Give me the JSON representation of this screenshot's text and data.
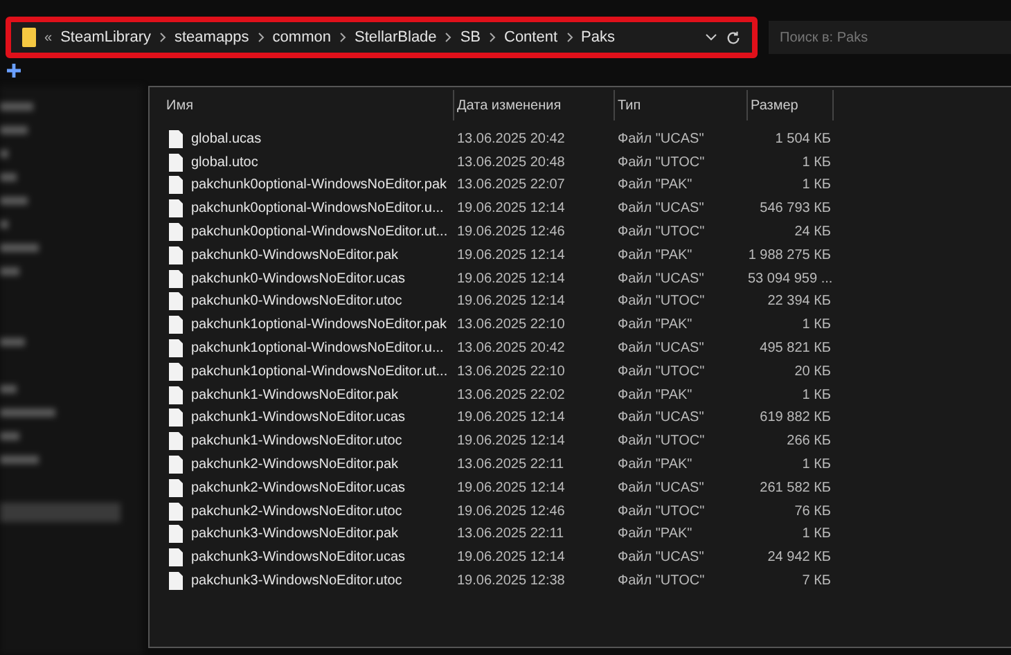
{
  "address_bar": {
    "overflow": "«",
    "crumbs": [
      "SteamLibrary",
      "steamapps",
      "common",
      "StellarBlade",
      "SB",
      "Content",
      "Paks"
    ],
    "highlighted": true
  },
  "search": {
    "placeholder": "Поиск в: Paks"
  },
  "table": {
    "columns": [
      "Имя",
      "Дата изменения",
      "Тип",
      "Размер"
    ],
    "rows": [
      {
        "name": "global.ucas",
        "date": "13.06.2025 20:42",
        "type": "Файл \"UCAS\"",
        "size": "1 504 КБ"
      },
      {
        "name": "global.utoc",
        "date": "13.06.2025 20:48",
        "type": "Файл \"UTOC\"",
        "size": "1 КБ"
      },
      {
        "name": "pakchunk0optional-WindowsNoEditor.pak",
        "date": "13.06.2025 22:07",
        "type": "Файл \"PAK\"",
        "size": "1 КБ"
      },
      {
        "name": "pakchunk0optional-WindowsNoEditor.u...",
        "date": "19.06.2025 12:14",
        "type": "Файл \"UCAS\"",
        "size": "546 793 КБ"
      },
      {
        "name": "pakchunk0optional-WindowsNoEditor.ut...",
        "date": "19.06.2025 12:46",
        "type": "Файл \"UTOC\"",
        "size": "24 КБ"
      },
      {
        "name": "pakchunk0-WindowsNoEditor.pak",
        "date": "19.06.2025 12:14",
        "type": "Файл \"PAK\"",
        "size": "1 988 275 КБ"
      },
      {
        "name": "pakchunk0-WindowsNoEditor.ucas",
        "date": "19.06.2025 12:14",
        "type": "Файл \"UCAS\"",
        "size": "53 094 959 ..."
      },
      {
        "name": "pakchunk0-WindowsNoEditor.utoc",
        "date": "19.06.2025 12:14",
        "type": "Файл \"UTOC\"",
        "size": "22 394 КБ"
      },
      {
        "name": "pakchunk1optional-WindowsNoEditor.pak",
        "date": "13.06.2025 22:10",
        "type": "Файл \"PAK\"",
        "size": "1 КБ"
      },
      {
        "name": "pakchunk1optional-WindowsNoEditor.u...",
        "date": "13.06.2025 20:42",
        "type": "Файл \"UCAS\"",
        "size": "495 821 КБ"
      },
      {
        "name": "pakchunk1optional-WindowsNoEditor.ut...",
        "date": "13.06.2025 22:10",
        "type": "Файл \"UTOC\"",
        "size": "20 КБ"
      },
      {
        "name": "pakchunk1-WindowsNoEditor.pak",
        "date": "13.06.2025 22:02",
        "type": "Файл \"PAK\"",
        "size": "1 КБ"
      },
      {
        "name": "pakchunk1-WindowsNoEditor.ucas",
        "date": "19.06.2025 12:14",
        "type": "Файл \"UCAS\"",
        "size": "619 882 КБ"
      },
      {
        "name": "pakchunk1-WindowsNoEditor.utoc",
        "date": "19.06.2025 12:14",
        "type": "Файл \"UTOC\"",
        "size": "266 КБ"
      },
      {
        "name": "pakchunk2-WindowsNoEditor.pak",
        "date": "13.06.2025 22:11",
        "type": "Файл \"PAK\"",
        "size": "1 КБ"
      },
      {
        "name": "pakchunk2-WindowsNoEditor.ucas",
        "date": "19.06.2025 12:14",
        "type": "Файл \"UCAS\"",
        "size": "261 582 КБ"
      },
      {
        "name": "pakchunk2-WindowsNoEditor.utoc",
        "date": "19.06.2025 12:46",
        "type": "Файл \"UTOC\"",
        "size": "76 КБ"
      },
      {
        "name": "pakchunk3-WindowsNoEditor.pak",
        "date": "13.06.2025 22:11",
        "type": "Файл \"PAK\"",
        "size": "1 КБ"
      },
      {
        "name": "pakchunk3-WindowsNoEditor.ucas",
        "date": "19.06.2025 12:14",
        "type": "Файл \"UCAS\"",
        "size": "24 942 КБ"
      },
      {
        "name": "pakchunk3-WindowsNoEditor.utoc",
        "date": "19.06.2025 12:38",
        "type": "Файл \"UTOC\"",
        "size": "7 КБ"
      }
    ]
  }
}
